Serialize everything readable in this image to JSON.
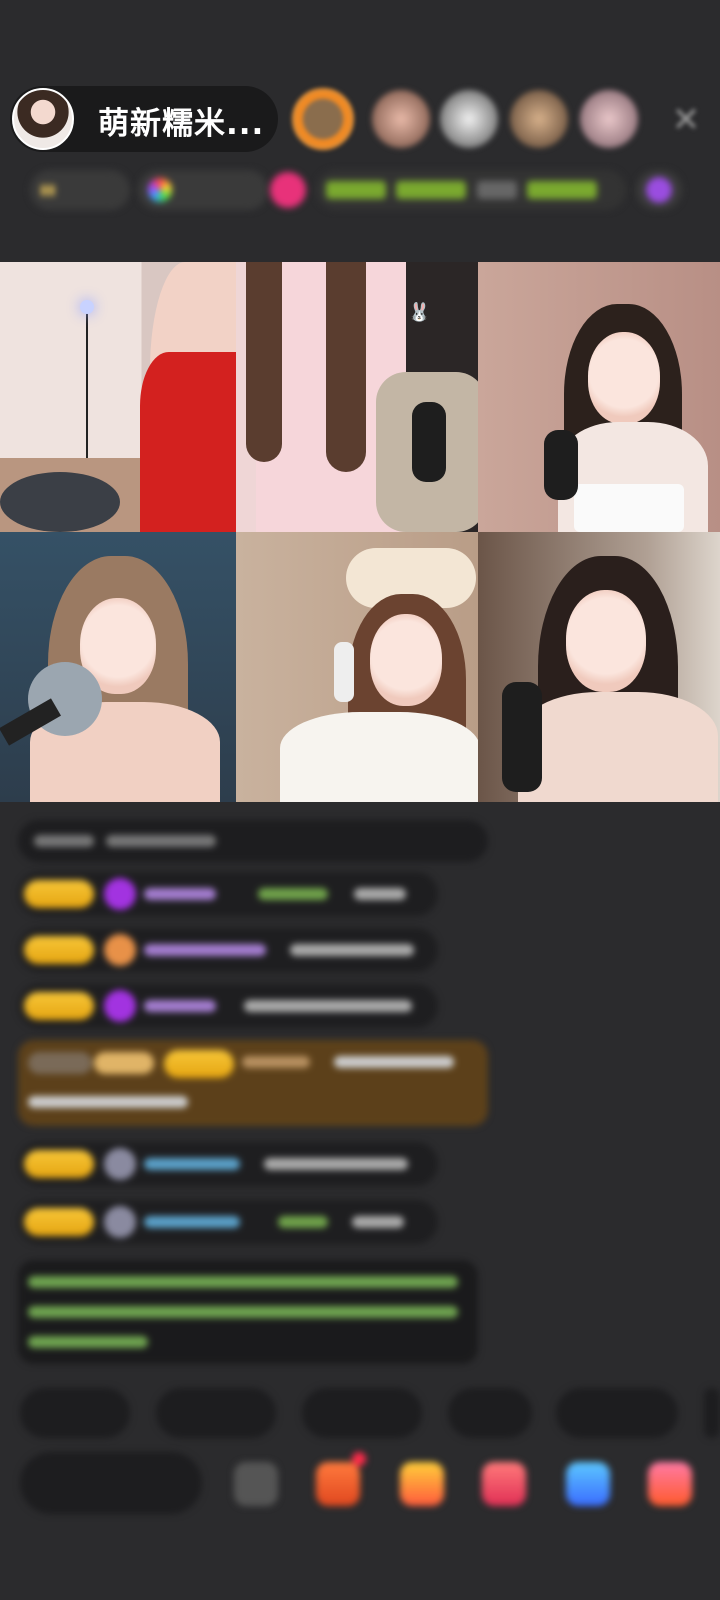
{
  "header": {
    "host_name": "萌新糯米...",
    "close_icon": "close-icon",
    "viewers": [
      "viewer-1",
      "viewer-2",
      "viewer-3",
      "viewer-4",
      "viewer-5"
    ]
  },
  "info_bar": {
    "chips": [
      "",
      "",
      "",
      "",
      "",
      ""
    ]
  },
  "video_grid": {
    "cells": [
      "guest-1",
      "guest-2",
      "guest-3",
      "guest-4",
      "guest-5",
      "guest-6"
    ]
  },
  "chat": {
    "messages": [
      "",
      "",
      "",
      "",
      "",
      "",
      "",
      ""
    ]
  },
  "quick_replies": [
    "",
    "",
    "",
    "",
    ""
  ],
  "bottom": {
    "say_placeholder": "",
    "icons": [
      "emoji-icon",
      "gift-box-icon",
      "fan-club-icon",
      "red-envelope-icon",
      "game-icon",
      "more-icon"
    ]
  },
  "colors": {
    "background": "#2b2b2d",
    "badge_gold": "#f7c638",
    "accent_purple": "#c7a3f0",
    "chat_green": "#8ad36b"
  }
}
